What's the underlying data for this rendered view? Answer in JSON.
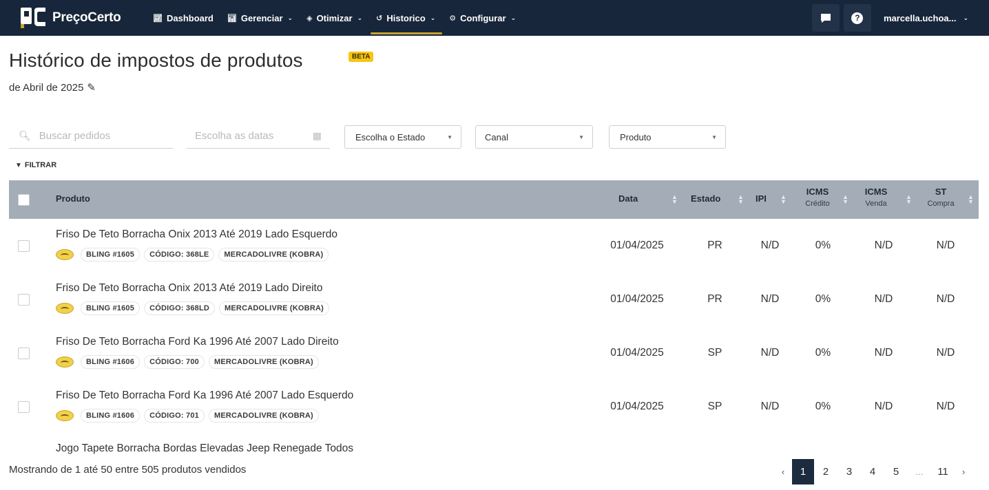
{
  "navbar": {
    "brand": "PreçoCerto",
    "items": [
      {
        "label": "Dashboard",
        "icon": "chart-icon"
      },
      {
        "label": "Gerenciar",
        "icon": "chart-icon"
      },
      {
        "label": "Otimizar",
        "icon": "layers-icon"
      },
      {
        "label": "Historico",
        "icon": "history-icon"
      },
      {
        "label": "Configurar",
        "icon": "gear-icon"
      }
    ],
    "user": "marcella.uchoa..."
  },
  "page": {
    "title": "Histórico de impostos de produtos",
    "badge": "BETA",
    "subtitle": "de Abril de 2025"
  },
  "filters": {
    "search_placeholder": "Buscar pedidos",
    "date_placeholder": "Escolha as datas",
    "state_select": "Escolha o Estado",
    "channel_select": "Canal",
    "product_select": "Produto",
    "filter_label": "FILTRAR"
  },
  "table": {
    "headers": {
      "product": "Produto",
      "date": "Data",
      "state": "Estado",
      "ipi": "IPI",
      "icms_credit": "ICMS",
      "icms_credit_sub": "Crédito",
      "icms_sale": "ICMS",
      "icms_sale_sub": "Venda",
      "st": "ST",
      "st_sub": "Compra"
    },
    "rows": [
      {
        "name": "Friso De Teto Borracha Onix 2013 Até 2019 Lado Esquerdo",
        "bling": "BLING #1605",
        "code": "CÓDIGO: 368LE",
        "channel": "MERCADOLIVRE (KOBRA)",
        "date": "01/04/2025",
        "state": "PR",
        "ipi": "N/D",
        "icms_credit": "0%",
        "icms_sale": "N/D",
        "st": "N/D"
      },
      {
        "name": "Friso De Teto Borracha Onix 2013 Até 2019 Lado Direito",
        "bling": "BLING #1605",
        "code": "CÓDIGO: 368LD",
        "channel": "MERCADOLIVRE (KOBRA)",
        "date": "01/04/2025",
        "state": "PR",
        "ipi": "N/D",
        "icms_credit": "0%",
        "icms_sale": "N/D",
        "st": "N/D"
      },
      {
        "name": "Friso De Teto Borracha Ford Ka 1996 Até 2007 Lado Direito",
        "bling": "BLING #1606",
        "code": "CÓDIGO: 700",
        "channel": "MERCADOLIVRE (KOBRA)",
        "date": "01/04/2025",
        "state": "SP",
        "ipi": "N/D",
        "icms_credit": "0%",
        "icms_sale": "N/D",
        "st": "N/D"
      },
      {
        "name": "Friso De Teto Borracha Ford Ka 1996 Até 2007 Lado Esquerdo",
        "bling": "BLING #1606",
        "code": "CÓDIGO: 701",
        "channel": "MERCADOLIVRE (KOBRA)",
        "date": "01/04/2025",
        "state": "SP",
        "ipi": "N/D",
        "icms_credit": "0%",
        "icms_sale": "N/D",
        "st": "N/D"
      }
    ],
    "partial_row_name": "Jogo Tapete Borracha Bordas Elevadas Jeep Renegade Todos"
  },
  "footer": {
    "showing": "Mostrando de 1 até 50 entre 505 produtos vendidos",
    "pages": [
      "1",
      "2",
      "3",
      "4",
      "5",
      "...",
      "11"
    ],
    "current_page": "1",
    "prev": "‹",
    "next": "›"
  },
  "colors": {
    "navbar_bg": "#17263a",
    "accent": "#c9a22f",
    "table_header_bg": "#a4adb7",
    "badge_bg": "#f5c518",
    "pager_current_bg": "#1c2b3d"
  }
}
